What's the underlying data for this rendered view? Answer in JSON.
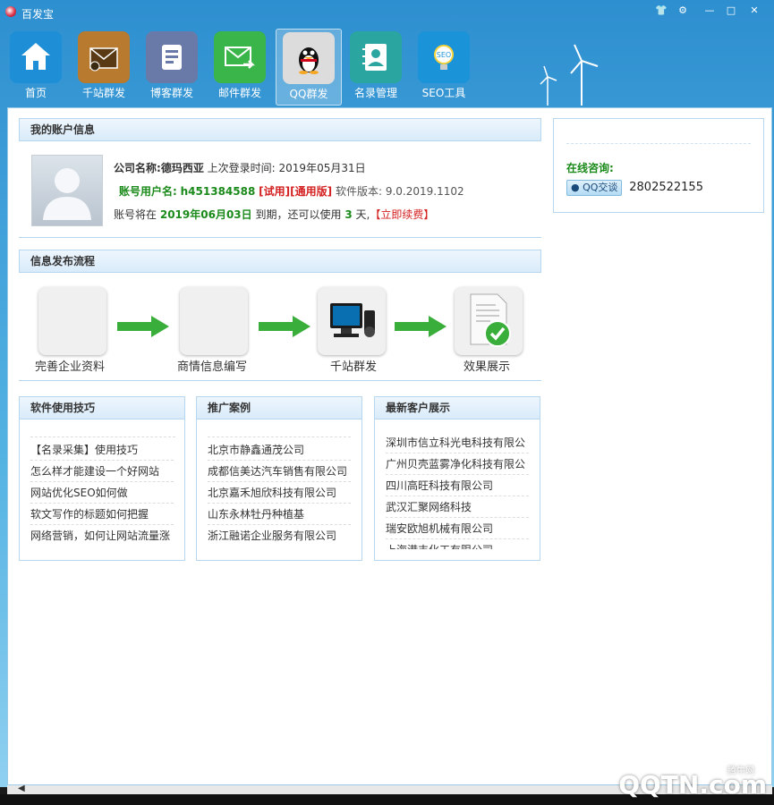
{
  "app": {
    "title": "百发宝"
  },
  "window_buttons": [
    "shirt-icon",
    "settings-icon",
    "minimize-icon",
    "maximize-icon",
    "close-icon"
  ],
  "toolbar": [
    {
      "label": "首页",
      "icon": "home-icon",
      "color": "#1e8fd6"
    },
    {
      "label": "千站群发",
      "icon": "envelope-stack-icon",
      "color": "#b77a2e"
    },
    {
      "label": "博客群发",
      "icon": "document-icon",
      "color": "#6a7aa8"
    },
    {
      "label": "邮件群发",
      "icon": "mail-forward-icon",
      "color": "#39b54a"
    },
    {
      "label": "QQ群发",
      "icon": "qq-penguin-icon",
      "color": "#dcdcdc",
      "active": true
    },
    {
      "label": "名录管理",
      "icon": "contacts-book-icon",
      "color": "#2aa5a0"
    },
    {
      "label": "SEO工具",
      "icon": "seo-bulb-icon",
      "color": "#1a93d8"
    }
  ],
  "account": {
    "header": "我的账户信息",
    "company_label": "公司名称:",
    "company": "德玛西亚",
    "last_login_label": "上次登录时间:",
    "last_login": "2019年05月31日",
    "username_label": "账号用户名:",
    "username": "h451384588",
    "tag_trial": "[试用]",
    "tag_general": "[通用版]",
    "version_label": "软件版本:",
    "version": "9.0.2019.1102",
    "expire_prefix": "账号将在",
    "expire_date": "2019年06月03日",
    "expire_mid": "到期，还可以使用",
    "days_left": "3",
    "days_suffix": "天,",
    "renew": "【立即续费】"
  },
  "process": {
    "header": "信息发布流程",
    "steps": [
      "完善企业资料",
      "商情信息编写",
      "千站群发",
      "效果展示"
    ]
  },
  "tips": {
    "header": "软件使用技巧",
    "items": [
      "【名录采集】使用技巧",
      "怎么样才能建设一个好网站",
      "网站优化SEO如何做",
      "软文写作的标题如何把握",
      "网络营销，如何让网站流量涨"
    ]
  },
  "cases": {
    "header": "推广案例",
    "items": [
      "北京市静鑫通茂公司",
      "成都信美达汽车销售有限公司",
      "北京嘉禾旭欣科技有限公司",
      "山东永林牡丹种植基",
      "浙江融诺企业服务有限公司"
    ]
  },
  "customers": {
    "header": "最新客户展示",
    "items": [
      "深圳市信立科光电科技有限公",
      "广州贝壳蓝雾净化科技有限公",
      "四川高旺科技有限公司",
      "武汉汇聚网络科技",
      "瑞安欧旭机械有限公司",
      "上海港丰化工有限公司"
    ]
  },
  "consult": {
    "label": "在线咨询:",
    "qq_badge": "QQ交谈",
    "qq_number": "2802522155"
  },
  "watermark": {
    "main": "QQTN.com",
    "sub": "腾牛网"
  }
}
